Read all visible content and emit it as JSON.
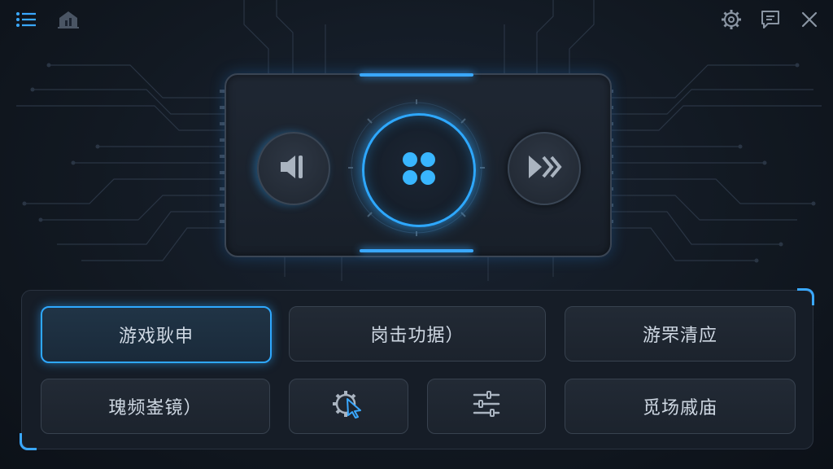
{
  "topbar": {
    "left_icons": [
      "list-icon",
      "home-icon"
    ],
    "right_icons": [
      "gear-icon",
      "message-icon",
      "close-icon"
    ]
  },
  "control_panel": {
    "left_icon": "volume-down-icon",
    "center_icon": "grid-dots-icon",
    "right_icon": "fast-forward-icon"
  },
  "buttons": {
    "row1": [
      "游戏耿申",
      "岗击功据）",
      "游罘清应"
    ],
    "row2_left": "瑰频崟镜）",
    "row2_icons": [
      "gear-cursor-icon",
      "sliders-icon"
    ],
    "row2_right": "觅场戚庙"
  },
  "colors": {
    "accent": "#2ea8ff",
    "background": "#121922"
  }
}
